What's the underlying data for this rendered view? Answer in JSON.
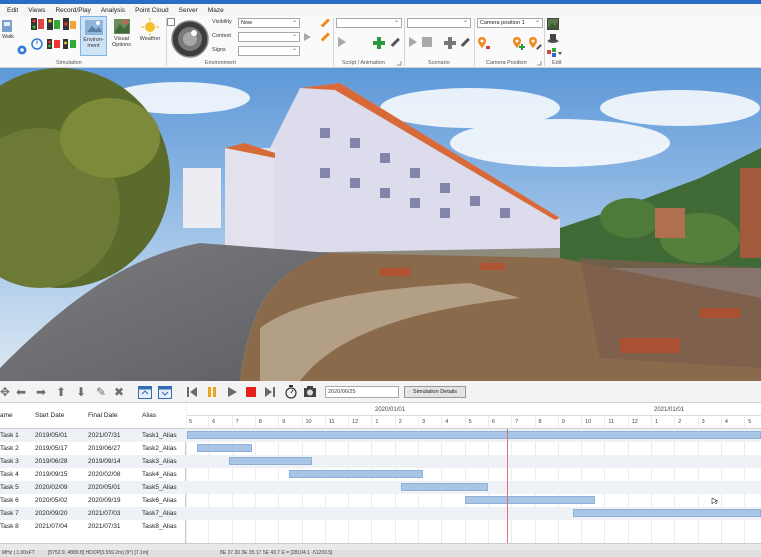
{
  "menu": [
    "Edit",
    "Views",
    "Record/Play",
    "Analysis",
    "Point Cloud",
    "Server",
    "Maze"
  ],
  "ribbon": {
    "left_btn": "Walk",
    "environment_btn": "Environ-\nment",
    "visual_options_btn": "Visual\nOptions",
    "weather_btn": "Weather",
    "visibility_label": "Visibility",
    "context_label": "Context",
    "signs_label": "Signs",
    "visibility_value": "Now",
    "camera_position_value": "Camera position 1",
    "group_simulation": "Simulation",
    "group_environment": "Environment",
    "group_script": "Script / Animation",
    "group_scenario": "Scenario",
    "group_camera": "Camera Position",
    "group_edit": "Edit"
  },
  "gantt_toolbar": {
    "date_value": "2020/06/25",
    "simulation_details": "Simulation Details"
  },
  "task_table": {
    "headers": [
      "ame",
      "Start Date",
      "Final Date",
      "Alias"
    ],
    "rows": [
      {
        "name": "Task 1",
        "start": "2019/05/01",
        "final": "2021/07/31",
        "alias": "Task1_Alias"
      },
      {
        "name": "Task 2",
        "start": "2019/05/17",
        "final": "2019/06/27",
        "alias": "Task2_Alias"
      },
      {
        "name": "Task 3",
        "start": "2019/06/28",
        "final": "2019/09/14",
        "alias": "Task3_Alias"
      },
      {
        "name": "Task 4",
        "start": "2019/09/15",
        "final": "2020/02/08",
        "alias": "Task4_Alias"
      },
      {
        "name": "Task 5",
        "start": "2020/02/09",
        "final": "2020/05/01",
        "alias": "Task5_Alias"
      },
      {
        "name": "Task 6",
        "start": "2020/05/02",
        "final": "2020/09/19",
        "alias": "Task6_Alias"
      },
      {
        "name": "Task 7",
        "start": "2020/09/20",
        "final": "2021/07/03",
        "alias": "Task7_Alias"
      },
      {
        "name": "Task 8",
        "start": "2021/07/04",
        "final": "2021/07/31",
        "alias": "Task8_Alias"
      }
    ]
  },
  "gantt": {
    "years": [
      "2020/01/01",
      "2021/01/01"
    ],
    "months": [
      "5",
      "6",
      "7",
      "8",
      "9",
      "10",
      "11",
      "12",
      "1",
      "2",
      "3",
      "4",
      "5",
      "6",
      "7",
      "8",
      "9",
      "10",
      "11",
      "12",
      "1",
      "2",
      "3",
      "4",
      "5"
    ]
  },
  "status": {
    "left": "MHz | 1.00xFT",
    "mid": "[5752.9, 4889.8]  HDOP[3.559.2m] (9°)  [7.1m]",
    "right": "8E 37.30 3E 35.17  5E 43.7 E = [28104.1 -51209.5]"
  },
  "colors": {
    "accent": "#2b6cc4",
    "gantt_bar": "#a9c5e6",
    "today_line": "#e07070",
    "alt_row": "#eef2f6"
  }
}
